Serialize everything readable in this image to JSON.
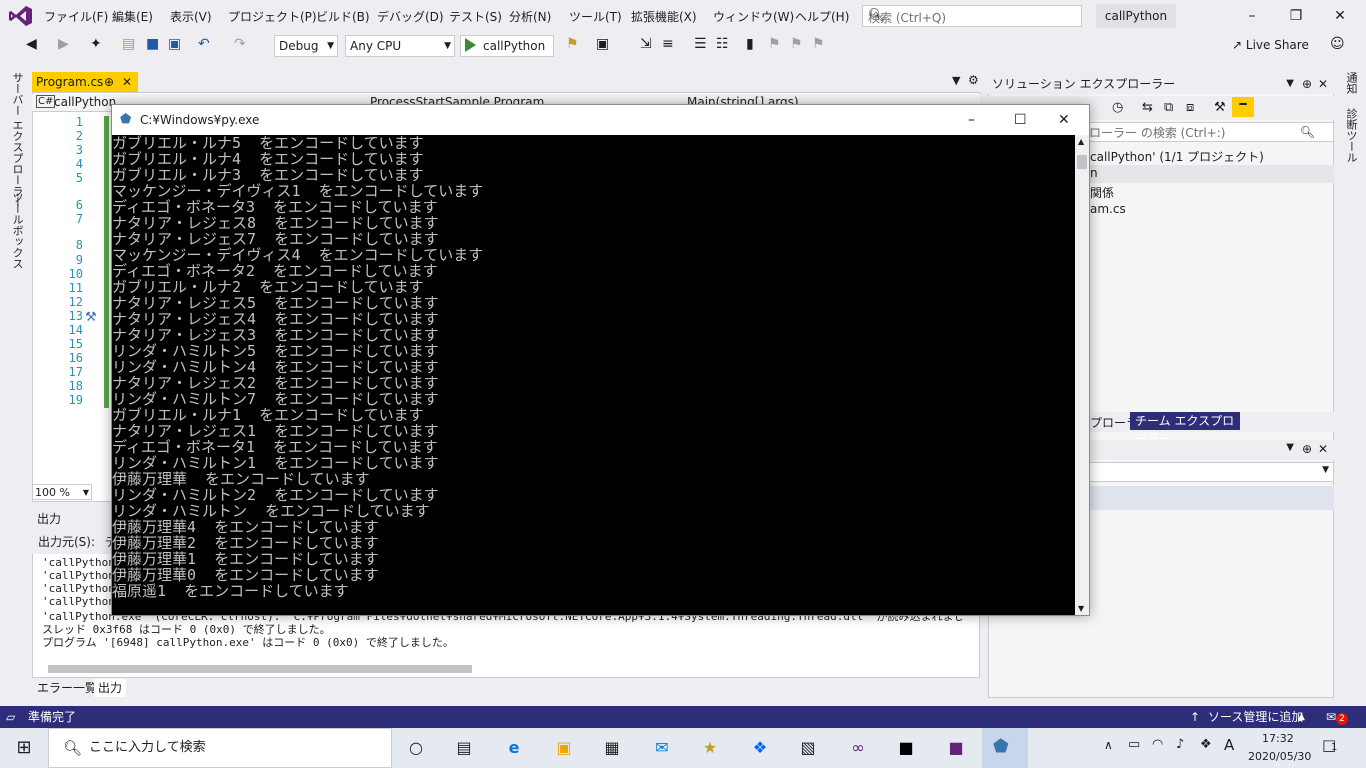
{
  "menubar": {
    "items": [
      "ファイル(F)",
      "編集(E)",
      "表示(V)",
      "プロジェクト(P)",
      "ビルド(B)",
      "デバッグ(D)",
      "テスト(S)",
      "分析(N)",
      "ツール(T)",
      "拡張機能(X)",
      "ウィンドウ(W)",
      "ヘルプ(H)"
    ],
    "search_placeholder": "検索 (Ctrl+Q)",
    "project_title": "callPython"
  },
  "toolbar": {
    "config": "Debug",
    "platform": "Any CPU",
    "run_label": "callPython",
    "live_share": "Live Share"
  },
  "leftstrip": {
    "server_explorer": "サーバー エクスプローラー",
    "toolbox": "ツールボックス"
  },
  "rightstrip": {
    "notifications": "通知",
    "diagnostics": "診断ツール"
  },
  "editor": {
    "tab_label": "Program.cs",
    "nav_project": "callPython",
    "nav_class": "ProcessStartSample.Program",
    "nav_member": "Main(string[] args)",
    "line_numbers": [
      "1",
      "2",
      "3",
      "4",
      "5",
      "6",
      "7",
      "8",
      "9",
      "10",
      "11",
      "12",
      "13",
      "14",
      "15",
      "16",
      "17",
      "18",
      "19"
    ],
    "zoom": "100 %"
  },
  "output": {
    "title": "出力",
    "source_label": "出力元(S):",
    "source_value": "デ",
    "lines": [
      "'callPython",
      "'callPython",
      "'callPython",
      "'callPython",
      "'callPython.exe' (CoreCLR: clrhost): 'C:¥Program Files¥dotnet¥shared¥Microsoft.NETCore.App¥3.1.4¥System.Threading.Thread.dll' が読み込まれました。シンボ",
      "スレッド 0x3f68 はコード 0 (0x0) で終了しました。",
      "プログラム '[6948] callPython.exe' はコード 0 (0x0) で終了しました。"
    ],
    "tab_errors": "エラー一覧",
    "tab_output": "出力"
  },
  "solution": {
    "title": "ソリューション エクスプローラー",
    "search_placeholder": "ソリューション エクスプローラー の検索 (Ctrl+:)",
    "search_visible": "ローラー の検索 (Ctrl+:)",
    "solution_line": "callPython' (1/1 プロジェクト)",
    "item_n": "n",
    "item_deps": "関係",
    "item_program": "am.cs",
    "tab_left": "プローラー",
    "tab_team": "チーム エクスプローラー"
  },
  "console": {
    "title": "C:¥Windows¥py.exe",
    "lines": [
      "ガブリエル・ルナ5  をエンコードしています",
      "ガブリエル・ルナ4  をエンコードしています",
      "ガブリエル・ルナ3  をエンコードしています",
      "マッケンジー・デイヴィス1  をエンコードしています",
      "ディエゴ・ボネータ3  をエンコードしています",
      "ナタリア・レジェス8  をエンコードしています",
      "ナタリア・レジェス7  をエンコードしています",
      "マッケンジー・デイヴィス4  をエンコードしています",
      "ディエゴ・ボネータ2  をエンコードしています",
      "ガブリエル・ルナ2  をエンコードしています",
      "ナタリア・レジェス5  をエンコードしています",
      "ナタリア・レジェス4  をエンコードしています",
      "ナタリア・レジェス3  をエンコードしています",
      "リンダ・ハミルトン5  をエンコードしています",
      "リンダ・ハミルトン4  をエンコードしています",
      "ナタリア・レジェス2  をエンコードしています",
      "リンダ・ハミルトン7  をエンコードしています",
      "ガブリエル・ルナ1  をエンコードしています",
      "ナタリア・レジェス1  をエンコードしています",
      "ディエゴ・ボネータ1  をエンコードしています",
      "リンダ・ハミルトン1  をエンコードしています",
      "伊藤万理華  をエンコードしています",
      "リンダ・ハミルトン2  をエンコードしています",
      "リンダ・ハミルトン  をエンコードしています",
      "伊藤万理華4  をエンコードしています",
      "伊藤万理華2  をエンコードしています",
      "伊藤万理華1  をエンコードしています",
      "伊藤万理華0  をエンコードしています",
      "福原遥1  をエンコードしています"
    ]
  },
  "statusbar": {
    "ready": "準備完了",
    "source_control": "ソース管理に追加",
    "badge": "2"
  },
  "taskbar": {
    "search_placeholder": "ここに入力して検索",
    "time": "17:32",
    "date": "2020/05/30",
    "ime": "A",
    "notification_count": "1"
  }
}
